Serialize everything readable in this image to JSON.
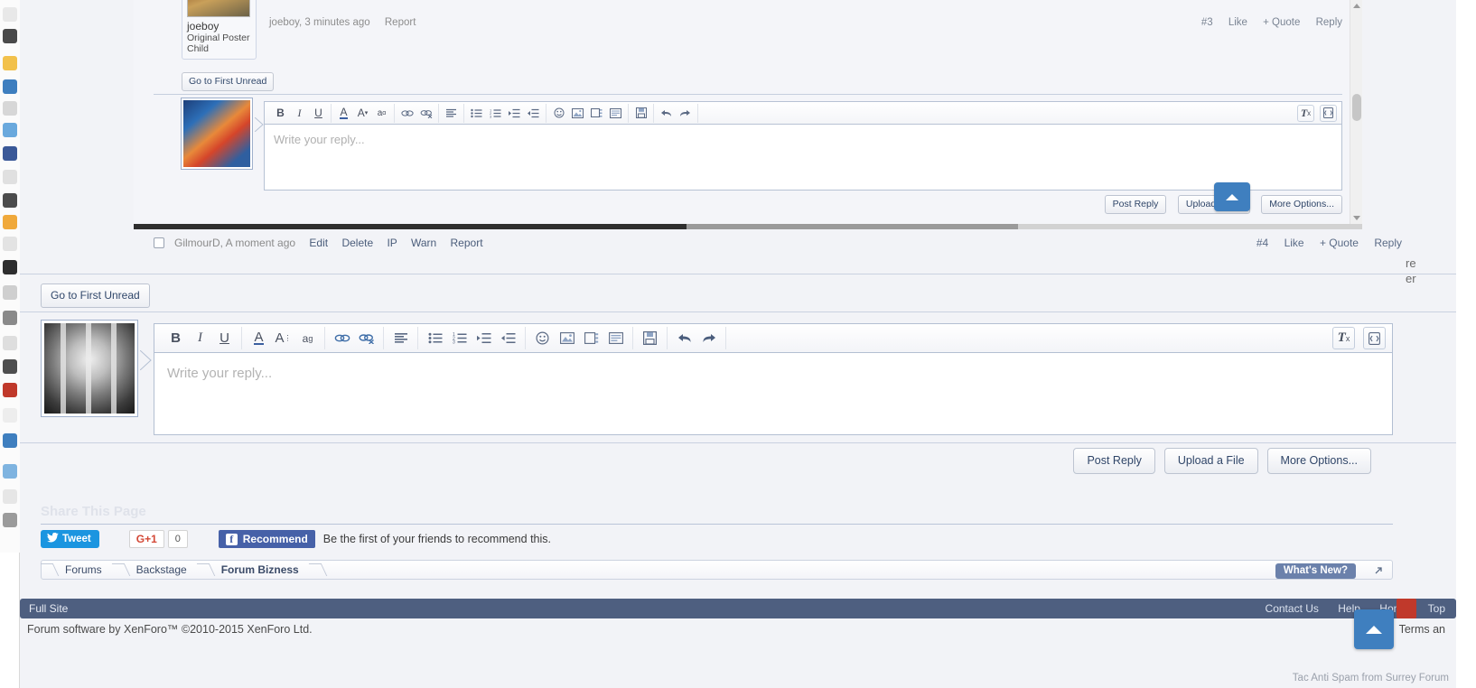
{
  "upper_post": {
    "user_name": "joeboy",
    "user_title": "Original Poster Child",
    "meta": "joeboy, 3 minutes ago",
    "report_label": "Report",
    "post_number": "#3",
    "like_label": "Like",
    "quote_label": "+ Quote",
    "reply_label": "Reply",
    "go_to_first_unread": "Go to First Unread"
  },
  "inline_editor": {
    "placeholder": "Write your reply...",
    "post_reply": "Post Reply",
    "upload_file": "Upload a File",
    "more_options": "More Options..."
  },
  "post4": {
    "meta": "GilmourD, A moment ago",
    "edit": "Edit",
    "delete": "Delete",
    "ip": "IP",
    "warn": "Warn",
    "report": "Report",
    "post_number": "#4",
    "like_label": "Like",
    "quote_label": "+ Quote",
    "reply_label": "Reply"
  },
  "main": {
    "go_to_first_unread": "Go to First Unread"
  },
  "editor": {
    "placeholder": "Write your reply...",
    "post_reply": "Post Reply",
    "upload_file": "Upload a File",
    "more_options": "More Options..."
  },
  "toolbar_icons": [
    "bold-icon",
    "italic-icon",
    "underline-icon",
    "text-color-icon",
    "font-size-icon",
    "font-family-icon",
    "insert-link-icon",
    "unlink-icon",
    "align-icon",
    "bullet-list-icon",
    "numbered-list-icon",
    "indent-icon",
    "outdent-icon",
    "smilie-icon",
    "insert-image-icon",
    "insert-media-icon",
    "insert-quote-icon",
    "draft-save-icon",
    "undo-icon",
    "redo-icon"
  ],
  "toolbar_right_icons": [
    "remove-formatting-icon",
    "toggle-bbcode-icon"
  ],
  "share": {
    "title": "Share This Page",
    "tweet": "Tweet",
    "gplus": "G+1",
    "gplus_count": "0",
    "recommend": "Recommend",
    "fb_text": "Be the first of your friends to recommend this."
  },
  "breadcrumb": {
    "items": [
      "Forums",
      "Backstage",
      "Forum Bizness"
    ],
    "whats_new": "What's New?"
  },
  "footer": {
    "full_site": "Full Site",
    "contact_us": "Contact Us",
    "help": "Help",
    "home": "Home",
    "top": "Top",
    "copyright": "Forum software by XenForo™ ©2010-2015 XenForo Ltd.",
    "terms": "Terms an",
    "tac": "Tac Anti Spam from Surrey Forum"
  },
  "right_clip": {
    "line1": "re",
    "line2": "er"
  },
  "colors": {
    "accent_blue": "#3f7fbf",
    "footer_bar": "#4e5f80",
    "twitter": "#1b95e0",
    "facebook": "#4661a8",
    "gplus_red": "#d34836",
    "page_bg": "#f2f3f7"
  }
}
